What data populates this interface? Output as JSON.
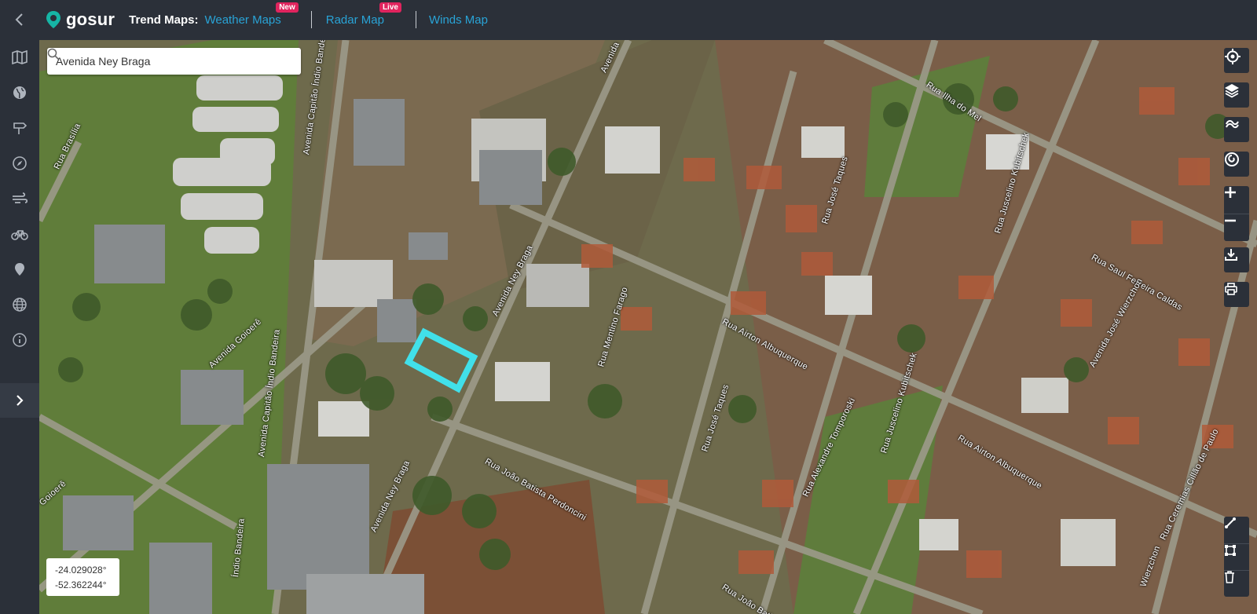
{
  "header": {
    "brand": "gosur",
    "trend_label": "Trend Maps:",
    "links": [
      {
        "label": "Weather Maps",
        "badge": "New"
      },
      {
        "label": "Radar Map",
        "badge": "Live"
      },
      {
        "label": "Winds Map",
        "badge": ""
      }
    ]
  },
  "sidebar": {
    "icons": [
      "map-icon",
      "globe-icon",
      "signpost-icon",
      "compass-icon",
      "wind-icon",
      "bicycle-icon",
      "pin-icon",
      "web-icon",
      "info-icon"
    ],
    "expand_icon": "chevron-right-icon"
  },
  "search": {
    "value": "Avenida Ney Braga"
  },
  "controls": [
    "locate-icon",
    "layers-icon",
    "satellite-icon",
    "swirl-icon",
    "zoom-in-icon",
    "zoom-out-icon",
    "download-icon",
    "print-icon",
    "draw-line-icon",
    "draw-polygon-icon",
    "trash-icon"
  ],
  "coords": {
    "lat": "-24.029028°",
    "lon": "-52.362244°"
  },
  "streets": {
    "s1": "Rua Brasília",
    "s2": "Avenida Capitão Índio Bandeira",
    "s3": "Avenida Capitão Índio Bandeira",
    "s4": "Avenida Goioerê",
    "s5": "Avenida Ney Braga",
    "s6": "Avenida Ney Braga",
    "s7": "Rua Mentino Farago",
    "s8": "Rua Airton Albuquerque",
    "s9": "Rua José Taques",
    "s10": "Rua José Taques",
    "s11": "Rua Ilha do Mel",
    "s12": "Rua Juscelino Kubitschek",
    "s13": "Rua Saul Ferreira Caldas",
    "s14": "Rua Airton Albuquerque",
    "s15": "Avenida José Wierzchon",
    "s16": "Rua João Batista Perdoncini",
    "s17": "Rua Alexandre Tomporoski",
    "s18": "Rua Juscelino Kubitschek",
    "s19": "Rua João Bati",
    "s20": "Rua Ceremias Cillão de Paulo",
    "s21": "Índio Bandeira",
    "s22": "Wierzchon",
    "s23": "Goioerê",
    "s24": "Avenida"
  },
  "colors": {
    "accent": "#29a3d6",
    "badge": "#e0245e",
    "highlight": "#41e0ea",
    "chrome": "#2b3039"
  }
}
